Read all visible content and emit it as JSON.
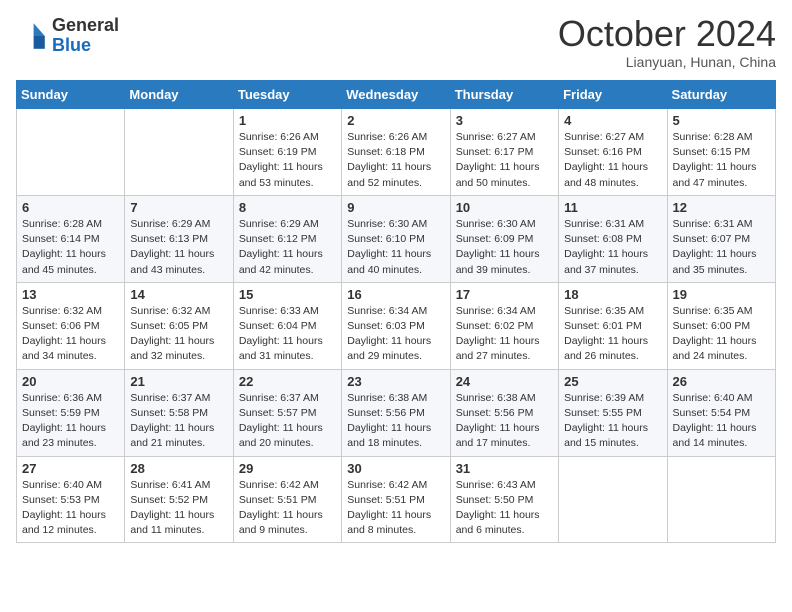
{
  "header": {
    "logo_line1": "General",
    "logo_line2": "Blue",
    "month_title": "October 2024",
    "location": "Lianyuan, Hunan, China"
  },
  "days_of_week": [
    "Sunday",
    "Monday",
    "Tuesday",
    "Wednesday",
    "Thursday",
    "Friday",
    "Saturday"
  ],
  "weeks": [
    [
      {
        "day": "",
        "sunrise": "",
        "sunset": "",
        "daylight": ""
      },
      {
        "day": "",
        "sunrise": "",
        "sunset": "",
        "daylight": ""
      },
      {
        "day": "1",
        "sunrise": "Sunrise: 6:26 AM",
        "sunset": "Sunset: 6:19 PM",
        "daylight": "Daylight: 11 hours and 53 minutes."
      },
      {
        "day": "2",
        "sunrise": "Sunrise: 6:26 AM",
        "sunset": "Sunset: 6:18 PM",
        "daylight": "Daylight: 11 hours and 52 minutes."
      },
      {
        "day": "3",
        "sunrise": "Sunrise: 6:27 AM",
        "sunset": "Sunset: 6:17 PM",
        "daylight": "Daylight: 11 hours and 50 minutes."
      },
      {
        "day": "4",
        "sunrise": "Sunrise: 6:27 AM",
        "sunset": "Sunset: 6:16 PM",
        "daylight": "Daylight: 11 hours and 48 minutes."
      },
      {
        "day": "5",
        "sunrise": "Sunrise: 6:28 AM",
        "sunset": "Sunset: 6:15 PM",
        "daylight": "Daylight: 11 hours and 47 minutes."
      }
    ],
    [
      {
        "day": "6",
        "sunrise": "Sunrise: 6:28 AM",
        "sunset": "Sunset: 6:14 PM",
        "daylight": "Daylight: 11 hours and 45 minutes."
      },
      {
        "day": "7",
        "sunrise": "Sunrise: 6:29 AM",
        "sunset": "Sunset: 6:13 PM",
        "daylight": "Daylight: 11 hours and 43 minutes."
      },
      {
        "day": "8",
        "sunrise": "Sunrise: 6:29 AM",
        "sunset": "Sunset: 6:12 PM",
        "daylight": "Daylight: 11 hours and 42 minutes."
      },
      {
        "day": "9",
        "sunrise": "Sunrise: 6:30 AM",
        "sunset": "Sunset: 6:10 PM",
        "daylight": "Daylight: 11 hours and 40 minutes."
      },
      {
        "day": "10",
        "sunrise": "Sunrise: 6:30 AM",
        "sunset": "Sunset: 6:09 PM",
        "daylight": "Daylight: 11 hours and 39 minutes."
      },
      {
        "day": "11",
        "sunrise": "Sunrise: 6:31 AM",
        "sunset": "Sunset: 6:08 PM",
        "daylight": "Daylight: 11 hours and 37 minutes."
      },
      {
        "day": "12",
        "sunrise": "Sunrise: 6:31 AM",
        "sunset": "Sunset: 6:07 PM",
        "daylight": "Daylight: 11 hours and 35 minutes."
      }
    ],
    [
      {
        "day": "13",
        "sunrise": "Sunrise: 6:32 AM",
        "sunset": "Sunset: 6:06 PM",
        "daylight": "Daylight: 11 hours and 34 minutes."
      },
      {
        "day": "14",
        "sunrise": "Sunrise: 6:32 AM",
        "sunset": "Sunset: 6:05 PM",
        "daylight": "Daylight: 11 hours and 32 minutes."
      },
      {
        "day": "15",
        "sunrise": "Sunrise: 6:33 AM",
        "sunset": "Sunset: 6:04 PM",
        "daylight": "Daylight: 11 hours and 31 minutes."
      },
      {
        "day": "16",
        "sunrise": "Sunrise: 6:34 AM",
        "sunset": "Sunset: 6:03 PM",
        "daylight": "Daylight: 11 hours and 29 minutes."
      },
      {
        "day": "17",
        "sunrise": "Sunrise: 6:34 AM",
        "sunset": "Sunset: 6:02 PM",
        "daylight": "Daylight: 11 hours and 27 minutes."
      },
      {
        "day": "18",
        "sunrise": "Sunrise: 6:35 AM",
        "sunset": "Sunset: 6:01 PM",
        "daylight": "Daylight: 11 hours and 26 minutes."
      },
      {
        "day": "19",
        "sunrise": "Sunrise: 6:35 AM",
        "sunset": "Sunset: 6:00 PM",
        "daylight": "Daylight: 11 hours and 24 minutes."
      }
    ],
    [
      {
        "day": "20",
        "sunrise": "Sunrise: 6:36 AM",
        "sunset": "Sunset: 5:59 PM",
        "daylight": "Daylight: 11 hours and 23 minutes."
      },
      {
        "day": "21",
        "sunrise": "Sunrise: 6:37 AM",
        "sunset": "Sunset: 5:58 PM",
        "daylight": "Daylight: 11 hours and 21 minutes."
      },
      {
        "day": "22",
        "sunrise": "Sunrise: 6:37 AM",
        "sunset": "Sunset: 5:57 PM",
        "daylight": "Daylight: 11 hours and 20 minutes."
      },
      {
        "day": "23",
        "sunrise": "Sunrise: 6:38 AM",
        "sunset": "Sunset: 5:56 PM",
        "daylight": "Daylight: 11 hours and 18 minutes."
      },
      {
        "day": "24",
        "sunrise": "Sunrise: 6:38 AM",
        "sunset": "Sunset: 5:56 PM",
        "daylight": "Daylight: 11 hours and 17 minutes."
      },
      {
        "day": "25",
        "sunrise": "Sunrise: 6:39 AM",
        "sunset": "Sunset: 5:55 PM",
        "daylight": "Daylight: 11 hours and 15 minutes."
      },
      {
        "day": "26",
        "sunrise": "Sunrise: 6:40 AM",
        "sunset": "Sunset: 5:54 PM",
        "daylight": "Daylight: 11 hours and 14 minutes."
      }
    ],
    [
      {
        "day": "27",
        "sunrise": "Sunrise: 6:40 AM",
        "sunset": "Sunset: 5:53 PM",
        "daylight": "Daylight: 11 hours and 12 minutes."
      },
      {
        "day": "28",
        "sunrise": "Sunrise: 6:41 AM",
        "sunset": "Sunset: 5:52 PM",
        "daylight": "Daylight: 11 hours and 11 minutes."
      },
      {
        "day": "29",
        "sunrise": "Sunrise: 6:42 AM",
        "sunset": "Sunset: 5:51 PM",
        "daylight": "Daylight: 11 hours and 9 minutes."
      },
      {
        "day": "30",
        "sunrise": "Sunrise: 6:42 AM",
        "sunset": "Sunset: 5:51 PM",
        "daylight": "Daylight: 11 hours and 8 minutes."
      },
      {
        "day": "31",
        "sunrise": "Sunrise: 6:43 AM",
        "sunset": "Sunset: 5:50 PM",
        "daylight": "Daylight: 11 hours and 6 minutes."
      },
      {
        "day": "",
        "sunrise": "",
        "sunset": "",
        "daylight": ""
      },
      {
        "day": "",
        "sunrise": "",
        "sunset": "",
        "daylight": ""
      }
    ]
  ]
}
